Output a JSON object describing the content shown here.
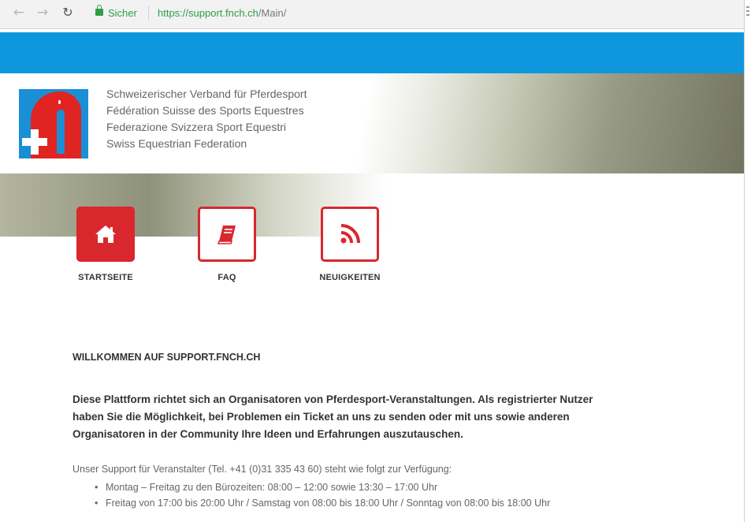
{
  "browser": {
    "secure_label": "Sicher",
    "url_host": "https://support.fnch.ch",
    "url_path": "/Main/",
    "back_icon": "arrow-left-icon",
    "forward_icon": "arrow-right-icon",
    "reload_icon": "reload-icon"
  },
  "colors": {
    "blue_band": "#0f97dd",
    "accent_red": "#d9272e",
    "secure_green": "#2e9e49"
  },
  "header": {
    "federation_names": [
      "Schweizerischer Verband für Pferdesport",
      "Fédération Suisse des Sports Equestres",
      "Federazione Svizzera Sport Equestri",
      "Swiss Equestrian Federation"
    ]
  },
  "nav": {
    "tiles": [
      {
        "label": "STARTSEITE",
        "icon": "home-icon"
      },
      {
        "label": "FAQ",
        "icon": "book-icon"
      },
      {
        "label": "NEUIGKEITEN",
        "icon": "rss-icon"
      }
    ]
  },
  "content": {
    "welcome_title": "WILLKOMMEN AUF SUPPORT.FNCH.CH",
    "intro_lines": [
      "Diese Plattform richtet sich an Organisatoren von Pferdesport-Veranstaltungen. Als registrierter Nutzer",
      "haben Sie die Möglichkeit, bei Problemen ein Ticket an uns zu senden oder mit uns sowie anderen",
      "Organisatoren in der Community Ihre Ideen und Erfahrungen auszutauschen."
    ],
    "support_hours_intro": "Unser Support für Veranstalter  (Tel. +41 (0)31 335 43 60) steht wie folgt zur Verfügung:",
    "support_hours": [
      "Montag – Freitag zu den Bürozeiten: 08:00 – 12:00 sowie 13:30 – 17:00 Uhr",
      "Freitag von 17:00 bis 20:00 Uhr / Samstag von 08:00 bis 18:00 Uhr / Sonntag von 08:00 bis 18:00 Uhr"
    ]
  }
}
